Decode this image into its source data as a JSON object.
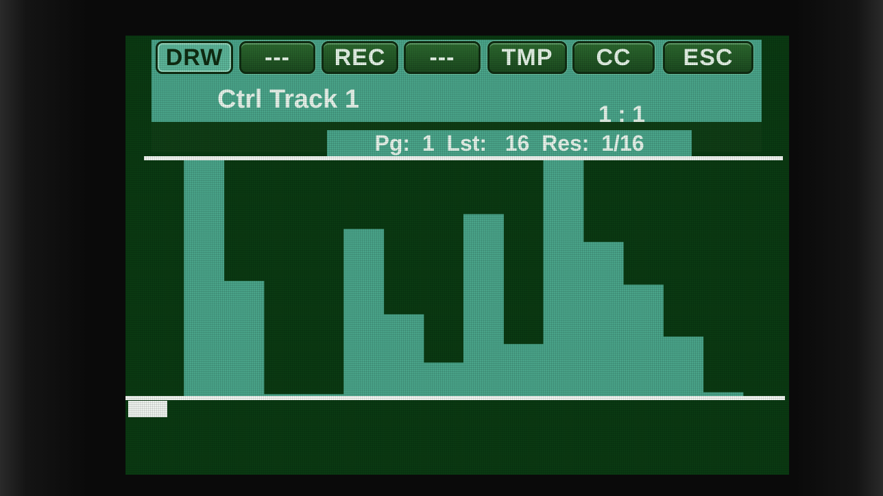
{
  "toolbar": {
    "buttons": [
      {
        "label": "DRW",
        "active": true
      },
      {
        "label": "---",
        "active": false
      },
      {
        "label": "REC",
        "active": false
      },
      {
        "label": "---",
        "active": false
      },
      {
        "label": "TMP",
        "active": false
      },
      {
        "label": "CC",
        "active": false
      },
      {
        "label": "ESC",
        "active": false
      }
    ]
  },
  "header": {
    "title": "Ctrl Track 1",
    "position": "1 : 1"
  },
  "info": {
    "text": "Pg:  1  Lst:   16  Res:  1/16"
  },
  "colors": {
    "screen_bg": "#0a3a12",
    "fill": "#4aa58a",
    "dark": "#0f3d15",
    "line": "#f2f6f2"
  },
  "graph": {
    "step_count": 16,
    "value_max": 127,
    "values": [
      0,
      127,
      62,
      1,
      1,
      90,
      44,
      18,
      98,
      28,
      127,
      83,
      60,
      32,
      2,
      0
    ]
  }
}
